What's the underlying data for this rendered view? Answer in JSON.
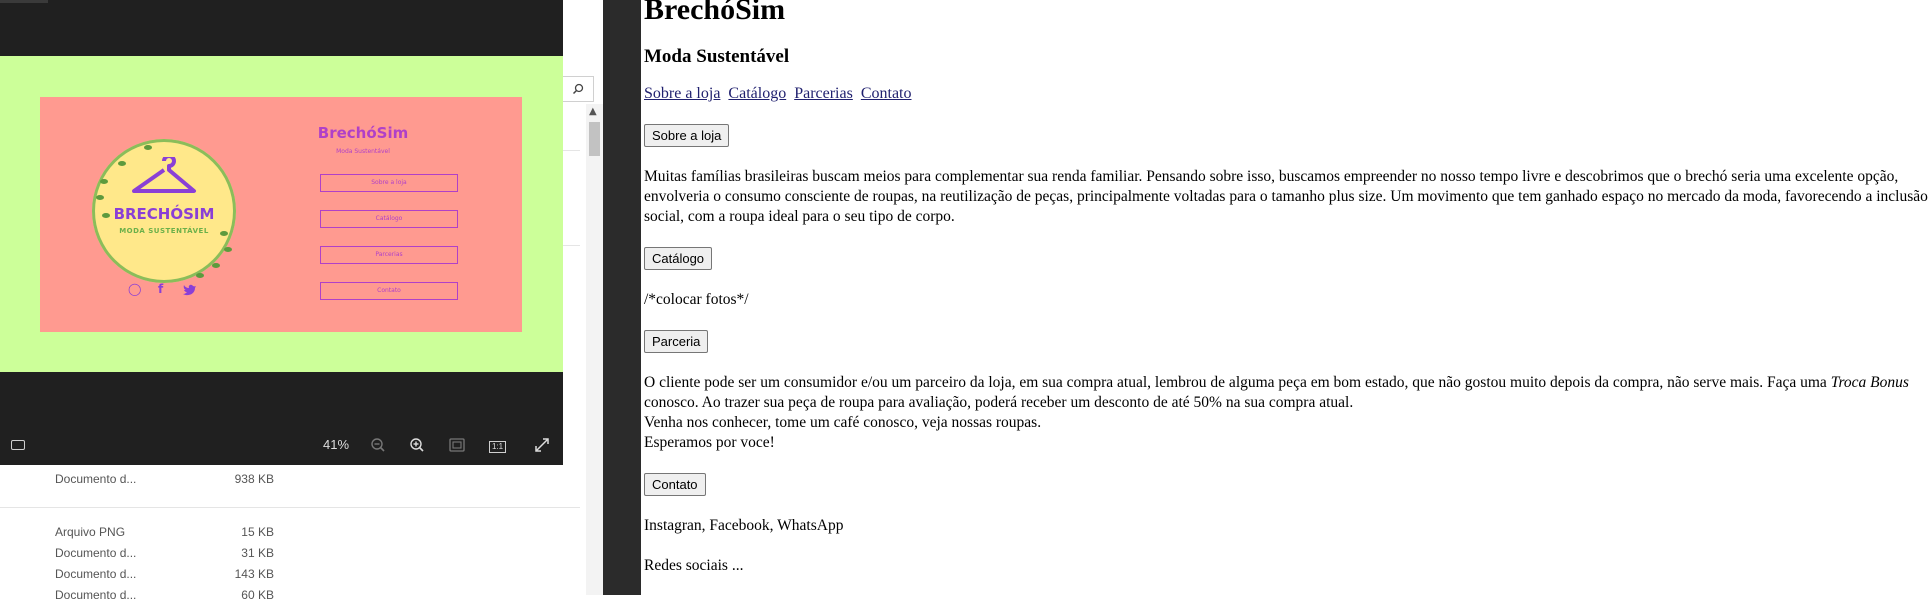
{
  "explorer": {
    "files": [
      {
        "type": "Documento d...",
        "size": "938 KB"
      },
      {
        "type": "Arquivo PNG",
        "size": "15 KB"
      },
      {
        "type": "Documento d...",
        "size": "31 KB"
      },
      {
        "type": "Documento d...",
        "size": "143 KB"
      },
      {
        "type": "Documento d...",
        "size": "60 KB"
      }
    ]
  },
  "viewer": {
    "zoom": "41%",
    "zoom_out_icon": "zoom-out-icon",
    "zoom_in_icon": "zoom-in-icon",
    "fit_icon": "fit-screen-icon",
    "actual_size_label": "1:1",
    "fullscreen_icon": "expand-icon",
    "canvas_bg": "#ccff99",
    "slide_bg": "#ff9a90"
  },
  "slide": {
    "logo_brand": "BRECHÓSIM",
    "logo_tagline": "MODA SUSTENTÁVEL",
    "title": "BrechóSim",
    "subtitle": "Moda Sustentável",
    "buttons": [
      "Sobre a loja",
      "Catálogo",
      "Parcerias",
      "Contato"
    ],
    "social_icons": [
      "instagram-icon",
      "facebook-icon",
      "twitter-icon"
    ]
  },
  "page": {
    "title": "BrechóSim",
    "subtitle": "Moda Sustentável",
    "nav": [
      "Sobre a loja",
      "Catálogo",
      "Parcerias",
      "Contato"
    ],
    "sections": {
      "about_button": "Sobre a loja",
      "about_text": "Muitas famílias brasileiras buscam meios para complementar sua renda familiar. Pensando sobre isso, buscamos empreender no nosso tempo livre e descobrimos que o brechó seria uma excelente opção, envolveria o consumo consciente de roupas, na reutilização de peças, principalmente voltadas para o tamanho plus size. Um movimento que tem ganhado espaço no mercado da moda, favorecendo a inclusão social, com a roupa ideal para o seu tipo de corpo.",
      "catalog_button": "Catálogo",
      "catalog_text": "/*colocar fotos*/",
      "partner_button": "Parceria",
      "partner_text_1": "O cliente pode ser um consumidor e/ou um parceiro da loja, em sua compra atual, lembrou de alguma peça em bom estado, que não gostou muito depois da compra, não serve mais. Faça uma ",
      "partner_text_em": "Troca Bonus",
      "partner_text_2": " conosco. Ao trazer sua peça de roupa para avaliação, poderá receber um desconto de até 50% na sua compra atual.",
      "partner_line_2": "Venha nos conhecer, tome um café conosco, veja nossas roupas.",
      "partner_line_3": "Esperamos por voce!",
      "contact_button": "Contato",
      "contact_text": "Instagran, Facebook, WhatsApp",
      "social_text": "Redes sociais ..."
    }
  }
}
